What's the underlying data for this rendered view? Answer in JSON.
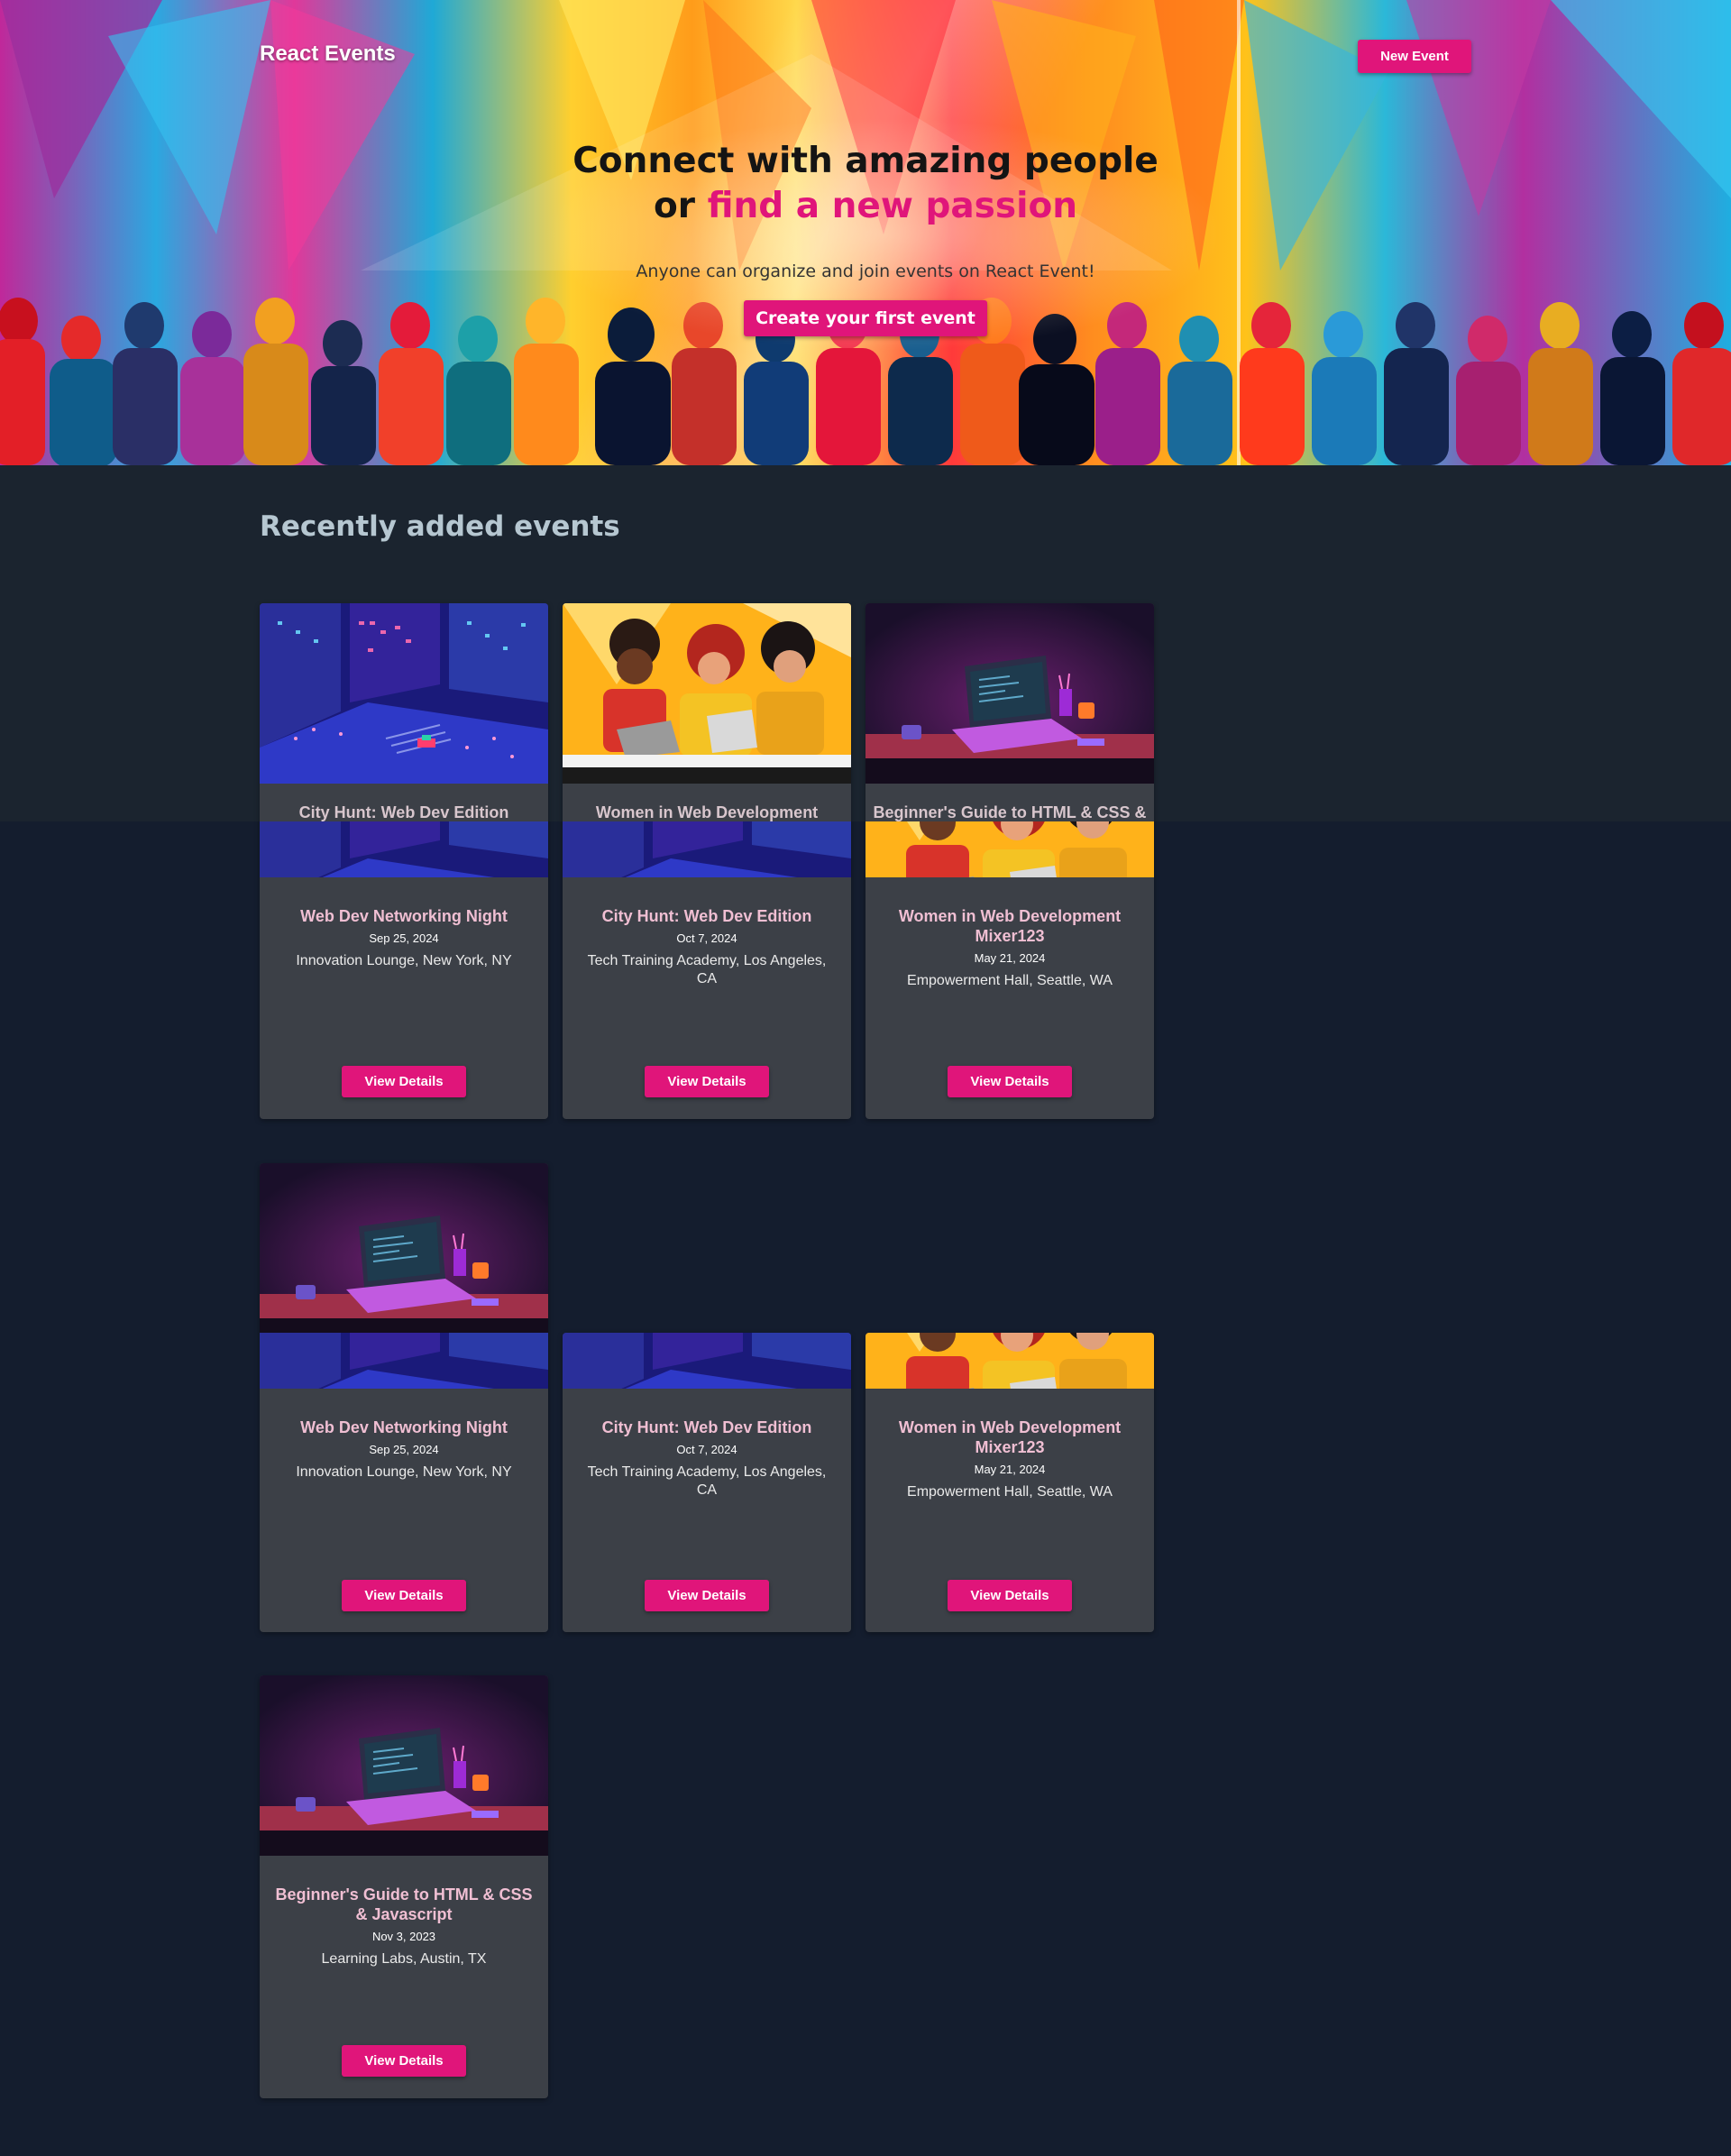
{
  "nav": {
    "brand": "React Events",
    "new_event_label": "New Event"
  },
  "hero": {
    "title_line1": "Connect with amazing people",
    "title_line2_prefix": "or ",
    "title_line2_accent": "find a new passion",
    "subtitle": "Anyone can organize and join events on React Event!",
    "cta_label": "Create your first event"
  },
  "section": {
    "title": "Recently added events"
  },
  "ghost_titles": [
    "City Hunt: Web Dev Edition",
    "Women in Web Development",
    "Beginner's Guide to HTML & CSS &"
  ],
  "events": [
    {
      "title": "Web Dev Networking Night",
      "date": "Sep 25, 2024",
      "location": "Innovation Lounge, New York, NY",
      "button": "View Details"
    },
    {
      "title": "City Hunt: Web Dev Edition",
      "date": "Oct 7, 2024",
      "location": "Tech Training Academy, Los Angeles, CA",
      "button": "View Details"
    },
    {
      "title": "Women in Web Development Mixer123",
      "date": "May 21, 2024",
      "location": "Empowerment Hall, Seattle, WA",
      "button": "View Details"
    },
    {
      "title": "Web Dev Networking Night",
      "date": "Sep 25, 2024",
      "location": "Innovation Lounge, New York, NY",
      "button": "View Details"
    },
    {
      "title": "City Hunt: Web Dev Edition",
      "date": "Oct 7, 2024",
      "location": "Tech Training Academy, Los Angeles, CA",
      "button": "View Details"
    },
    {
      "title": "Women in Web Development Mixer123",
      "date": "May 21, 2024",
      "location": "Empowerment Hall, Seattle, WA",
      "button": "View Details"
    },
    {
      "title": "Beginner's Guide to HTML & CSS & Javascript",
      "date": "Nov 3, 2023",
      "location": "Learning Labs, Austin, TX",
      "button": "View Details"
    }
  ],
  "colors": {
    "accent": "#e0157a",
    "card_bg": "#3c4047",
    "page_bg": "#141d2e",
    "band_bg": "#1b242f",
    "card_title": "#f0bfd3"
  }
}
